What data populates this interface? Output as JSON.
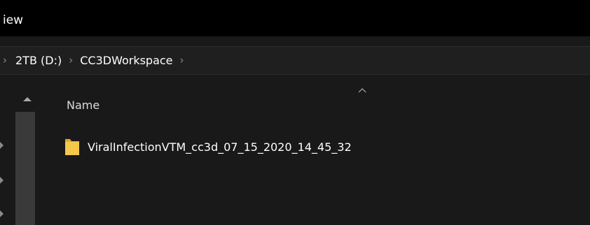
{
  "menubar": {
    "view_label": "iew"
  },
  "address": {
    "crumbs": [
      "2TB (D:)",
      "CC3DWorkspace"
    ],
    "separator": "›"
  },
  "file_list": {
    "name_header": "Name",
    "items": [
      {
        "name": "ViralInfectionVTM_cc3d_07_15_2020_14_45_32",
        "icon": "folder-icon"
      }
    ]
  },
  "colors": {
    "background": "#191919",
    "menubar": "#000000",
    "folder": "#f4c84a",
    "text": "#ffffff"
  }
}
